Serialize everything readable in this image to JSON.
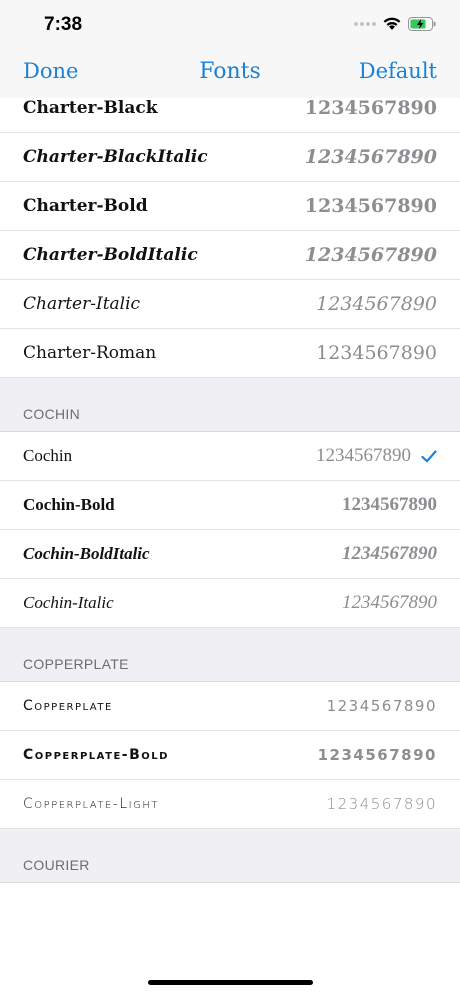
{
  "status": {
    "time": "7:38"
  },
  "nav": {
    "done_label": "Done",
    "title": "Fonts",
    "default_label": "Default"
  },
  "fonts_charter": [
    {
      "name": "Charter-Black",
      "sample": "1234567890"
    },
    {
      "name": "Charter-BlackItalic",
      "sample": "1234567890"
    },
    {
      "name": "Charter-Bold",
      "sample": "1234567890"
    },
    {
      "name": "Charter-BoldItalic",
      "sample": "1234567890"
    },
    {
      "name": "Charter-Italic",
      "sample": "1234567890"
    },
    {
      "name": "Charter-Roman",
      "sample": "1234567890"
    }
  ],
  "section_cochin": {
    "header": "COCHIN"
  },
  "fonts_cochin": [
    {
      "name": "Cochin",
      "sample": "1234567890",
      "selected": true
    },
    {
      "name": "Cochin-Bold",
      "sample": "1234567890"
    },
    {
      "name": "Cochin-BoldItalic",
      "sample": "1234567890"
    },
    {
      "name": "Cochin-Italic",
      "sample": "1234567890"
    }
  ],
  "section_copperplate": {
    "header": "COPPERPLATE"
  },
  "fonts_copperplate": [
    {
      "name": "Copperplate",
      "sample": "1234567890"
    },
    {
      "name": "Copperplate-Bold",
      "sample": "1234567890"
    },
    {
      "name": "Copperplate-Light",
      "sample": "1234567890"
    }
  ],
  "section_courier": {
    "header": "COURIER"
  },
  "colors": {
    "accent": "#1a82d6",
    "background_group": "#efeff4",
    "sample_text": "#8d8d92"
  }
}
